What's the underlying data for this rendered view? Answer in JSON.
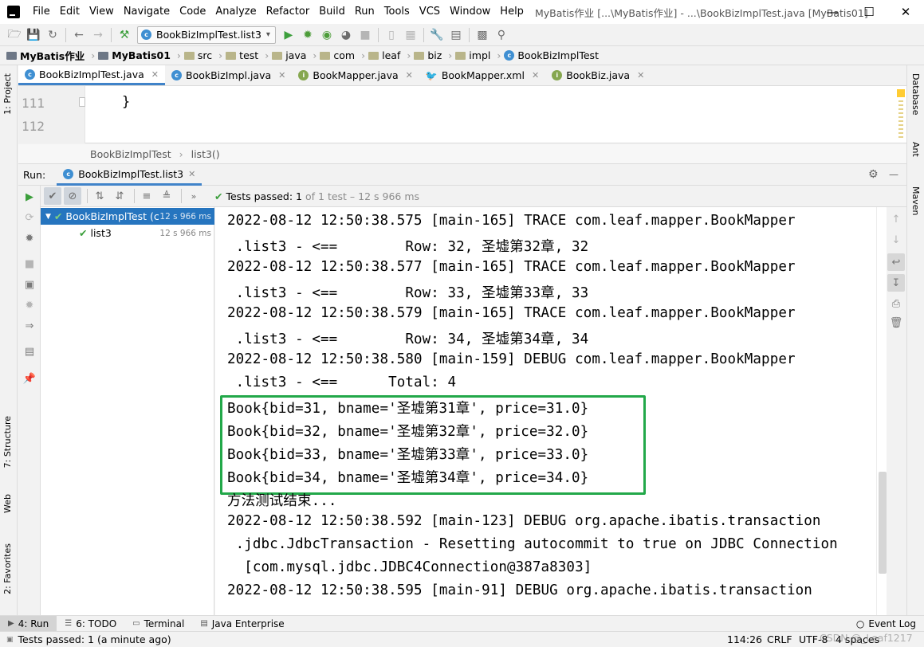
{
  "titlebar": {
    "menus": [
      "File",
      "Edit",
      "View",
      "Navigate",
      "Code",
      "Analyze",
      "Refactor",
      "Build",
      "Run",
      "Tools",
      "VCS",
      "Window",
      "Help"
    ],
    "window_title": "MyBatis作业 [...\\MyBatis作业] - ...\\BookBizImplTest.java [MyBatis01]"
  },
  "toolbar": {
    "run_config": "BookBizImplTest.list3"
  },
  "breadcrumb": [
    "MyBatis作业",
    "MyBatis01",
    "src",
    "test",
    "java",
    "com",
    "leaf",
    "biz",
    "impl",
    "BookBizImplTest"
  ],
  "left_strip": [
    "1: Project",
    "7: Structure",
    "Web",
    "2: Favorites"
  ],
  "right_strip": [
    "Database",
    "Ant",
    "Maven"
  ],
  "editor_tabs": [
    {
      "label": "BookBizImplTest.java",
      "icon": "c",
      "color": "#3f8fd2"
    },
    {
      "label": "BookBizImpl.java",
      "icon": "c",
      "color": "#3f8fd2"
    },
    {
      "label": "BookMapper.java",
      "icon": "i",
      "color": "#86a74f"
    },
    {
      "label": "BookMapper.xml",
      "icon": "bird",
      "color": "#7a3d26"
    },
    {
      "label": "BookBiz.java",
      "icon": "i",
      "color": "#86a74f"
    }
  ],
  "editor": {
    "lines": [
      {
        "num": "111",
        "code": "}"
      },
      {
        "num": "112",
        "code": ""
      }
    ]
  },
  "editor_breadcrumb": [
    "BookBizImplTest",
    "list3()"
  ],
  "run_panel": {
    "label": "Run:",
    "tab": "BookBizImplTest.list3"
  },
  "test_status": {
    "passed_label": "Tests passed:",
    "passed_count": "1",
    "detail": "of 1 test – 12 s 966 ms"
  },
  "test_tree": [
    {
      "label": "BookBizImplTest (c",
      "time": "12 s 966 ms"
    },
    {
      "label": "list3",
      "time": "12 s 966 ms"
    }
  ],
  "console": [
    "2022-08-12 12:50:38.575 [main-165] TRACE com.leaf.mapper.BookMapper",
    " .list3 - <==        Row: 32, 圣墟第32章, 32",
    "2022-08-12 12:50:38.577 [main-165] TRACE com.leaf.mapper.BookMapper",
    " .list3 - <==        Row: 33, 圣墟第33章, 33",
    "2022-08-12 12:50:38.579 [main-165] TRACE com.leaf.mapper.BookMapper",
    " .list3 - <==        Row: 34, 圣墟第34章, 34",
    "2022-08-12 12:50:38.580 [main-159] DEBUG com.leaf.mapper.BookMapper",
    " .list3 - <==      Total: 4",
    "Book{bid=31, bname='圣墟第31章', price=31.0}",
    "Book{bid=32, bname='圣墟第32章', price=32.0}",
    "Book{bid=33, bname='圣墟第33章', price=33.0}",
    "Book{bid=34, bname='圣墟第34章', price=34.0}",
    "方法测试结束...",
    "2022-08-12 12:50:38.592 [main-123] DEBUG org.apache.ibatis.transaction",
    " .jdbc.JdbcTransaction - Resetting autocommit to true on JDBC Connection",
    "  [com.mysql.jdbc.JDBC4Connection@387a8303]",
    "2022-08-12 12:50:38.595 [main-91] DEBUG org.apache.ibatis.transaction"
  ],
  "bottom_tabs": [
    {
      "label": "4: Run",
      "icon": "▶"
    },
    {
      "label": "6: TODO",
      "icon": "☰"
    },
    {
      "label": "Terminal",
      "icon": "▭"
    },
    {
      "label": "Java Enterprise",
      "icon": "▤"
    }
  ],
  "event_log": "Event Log",
  "status_bar": {
    "message": "Tests passed: 1 (a minute ago)",
    "position": "114:26",
    "line_sep": "CRLF",
    "encoding": "UTF-8",
    "indent": "4 spaces",
    "watermark": "CSDN @_Leaf1217"
  },
  "colors": {
    "accent": "#4083c9",
    "selection": "#2675bf",
    "highlight_box": "#22a849",
    "run_green": "#3c9f3c"
  }
}
